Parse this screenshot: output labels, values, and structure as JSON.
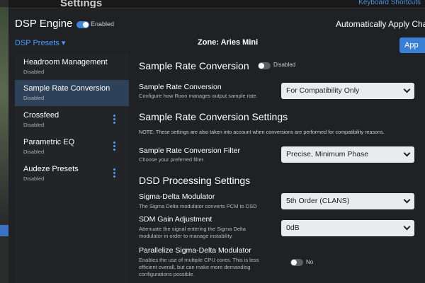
{
  "background": {
    "page_title": "Settings",
    "link": "Keyboard Shortcuts"
  },
  "header": {
    "title": "DSP Engine",
    "enabled_state": "Enabled",
    "auto_apply_label": "Automatically Apply Chan"
  },
  "subheader": {
    "presets_label": "DSP Presets ▾",
    "zone_label": "Zone: Aries Mini",
    "apply_label": "App"
  },
  "sidebar": {
    "items": [
      {
        "title": "Headroom Management",
        "status": "Disabled"
      },
      {
        "title": "Sample Rate Conversion",
        "status": "Disabled"
      },
      {
        "title": "Crossfeed",
        "status": "Disabled"
      },
      {
        "title": "Parametric EQ",
        "status": "Disabled"
      },
      {
        "title": "Audeze Presets",
        "status": "Disabled"
      }
    ]
  },
  "main": {
    "section_title": "Sample Rate Conversion",
    "section_toggle_label": "Disabled",
    "src_label": "Sample Rate Conversion",
    "src_desc": "Configure how Roon manages output sample rate.",
    "src_value": "For Compatibility Only",
    "settings_title": "Sample Rate Conversion Settings",
    "settings_note": "NOTE: These settings are also taken into account when conversions are performed for compatibility reasons.",
    "filter_label": "Sample Rate Conversion Filter",
    "filter_desc": "Choose your preferred filter.",
    "filter_value": "Precise, Minimum Phase",
    "dsd_title": "DSD Processing Settings",
    "sdm_label": "Sigma-Delta Modulator",
    "sdm_desc": "The Sigma Delta modulator converts PCM to DSD",
    "sdm_value": "5th Order (CLANS)",
    "gain_label": "SDM Gain Adjustment",
    "gain_desc_1": "Attenuate the signal entering the Sigma Delta",
    "gain_desc_2": "modulator in order to manage instability.",
    "gain_value": "0dB",
    "parallel_label": "Parallelize Sigma-Delta Modulator",
    "parallel_desc_1": "Enables the use of multiple CPU cores. This is less",
    "parallel_desc_2": "efficient overall, but can make more demanding",
    "parallel_desc_3": "configurations possible.",
    "parallel_toggle_label": "No"
  },
  "colors": {
    "accent": "#3d87d8",
    "link": "#4a9eff",
    "active_item": "#2d4258"
  }
}
